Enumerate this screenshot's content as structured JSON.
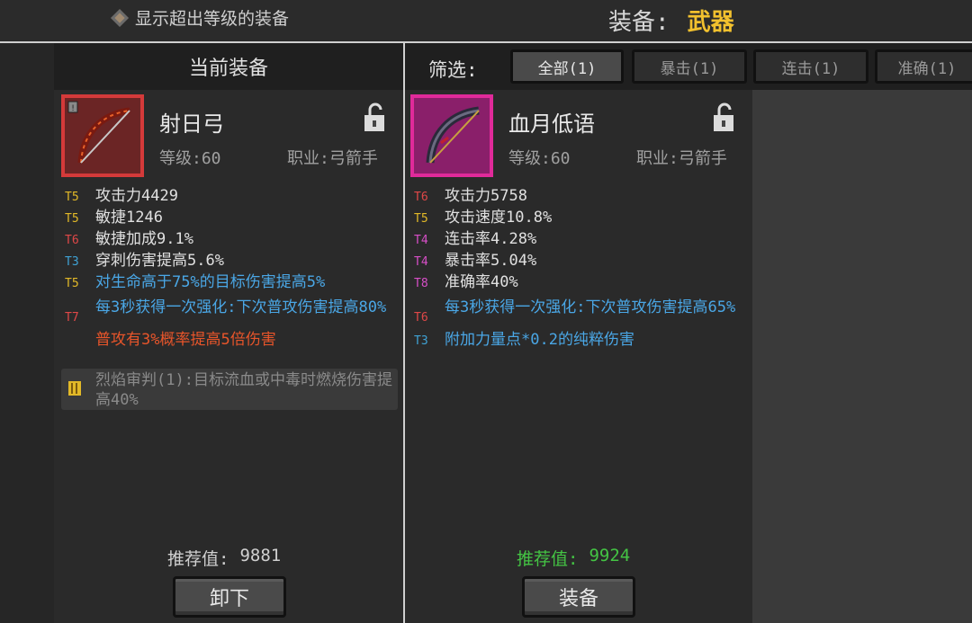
{
  "top": {
    "toggle_label": "显示超出等级的装备",
    "title_label": "装备:",
    "title_value": "武器"
  },
  "current": {
    "header": "当前装备",
    "name": "射日弓",
    "level": "等级:60",
    "class": "职业:弓箭手",
    "stats": [
      {
        "tier": "T5",
        "text": "攻击力4429"
      },
      {
        "tier": "T5",
        "text": "敏捷1246"
      },
      {
        "tier": "T6",
        "text": "敏捷加成9.1%"
      },
      {
        "tier": "T3",
        "text": "穿刺伤害提高5.6%"
      },
      {
        "tier": "T5",
        "text": "对生命高于75%的目标伤害提高5%"
      },
      {
        "tier": "T7",
        "text": "每3秒获得一次强化:下次普攻伤害提高80%"
      }
    ],
    "special": "普攻有3%概率提高5倍伤害",
    "set_effect": "烈焰审判(1):目标流血或中毒时燃烧伤害提高40%",
    "recommend_label": "推荐值:",
    "recommend_value": "9881",
    "unequip_label": "卸下"
  },
  "filter": {
    "label": "筛选:",
    "tabs": [
      "全部(1)",
      "暴击(1)",
      "连击(1)",
      "准确(1)"
    ]
  },
  "candidate": {
    "name": "血月低语",
    "level": "等级:60",
    "class": "职业:弓箭手",
    "stats": [
      {
        "tier": "T6",
        "text": "攻击力5758"
      },
      {
        "tier": "T5",
        "text": "攻击速度10.8%"
      },
      {
        "tier": "T4",
        "text": "连击率4.28%"
      },
      {
        "tier": "T4",
        "text": "暴击率5.04%"
      },
      {
        "tier": "T8",
        "text": "准确率40%"
      },
      {
        "tier": "T6",
        "text": "每3秒获得一次强化:下次普攻伤害提高65%"
      },
      {
        "tier": "T3",
        "text": "附加力量点*0.2的纯粹伤害"
      }
    ],
    "recommend_label": "推荐值:",
    "recommend_value": "9924",
    "equip_label": "装备"
  },
  "colors": {
    "title_accent": "#f2c12e",
    "recommend_better": "#44c444",
    "rarity_red": "#d43a3a",
    "rarity_pink": "#e02a9a"
  }
}
